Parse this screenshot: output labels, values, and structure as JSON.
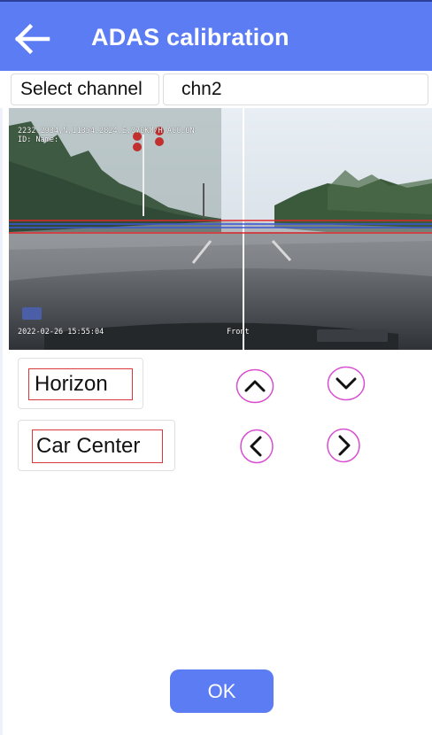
{
  "header": {
    "title": "ADAS calibration",
    "back_icon": "arrow-left-icon"
  },
  "channel": {
    "label": "Select channel",
    "value": "chn2"
  },
  "camera": {
    "osd_line1": "2232.2934,N,11354.2824,E,070KM/H ACC:ON",
    "osd_line2": "ID: Name:",
    "timestamp": "2022-02-26 15:55:04",
    "view_label": "Front"
  },
  "controls": {
    "horizon_label": "Horizon",
    "car_center_label": "Car Center",
    "up_icon": "chevron-up-icon",
    "down_icon": "chevron-down-icon",
    "left_icon": "chevron-left-icon",
    "right_icon": "chevron-right-icon"
  },
  "footer": {
    "ok_label": "OK"
  },
  "colors": {
    "primary": "#5b7cf2",
    "highlight_border": "#d9383a",
    "arrow_ring": "#d84fd0",
    "calibration_red": "#e0282a",
    "calibration_blue": "#3a56d8"
  }
}
